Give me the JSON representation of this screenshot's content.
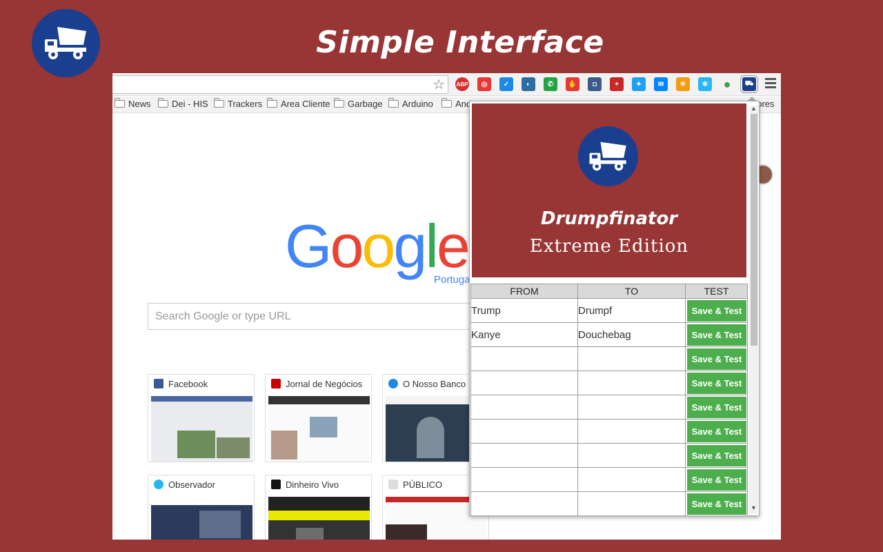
{
  "headline": "Simple Interface",
  "browser": {
    "bookmarks": [
      "News",
      "Dei - HIS",
      "Trackers",
      "Area Cliente",
      "Garbage",
      "Arduino",
      "And"
    ],
    "bookmarks_tail": "dores",
    "search_placeholder": "Search Google or type URL",
    "google_sub": "Portugal",
    "tiles": [
      "Facebook",
      "Jornal de Negócios",
      "O Nosso Banco",
      "Observador",
      "Dinheiro Vivo",
      "PÚBLICO"
    ],
    "extensions": [
      "adblock-icon",
      "adobe-icon",
      "chart-icon",
      "browser-icon",
      "whatsapp-icon",
      "stop-hand-icon",
      "instagram-icon",
      "plus-icon",
      "twitter-icon",
      "messenger-icon",
      "color-icon",
      "network-icon",
      "evernote-icon",
      "drumpfinator-icon"
    ]
  },
  "popup": {
    "title": "Drumpfinator",
    "subtitle": "Extreme Edition",
    "headers": {
      "from": "FROM",
      "to": "TO",
      "test": "TEST"
    },
    "button_label": "Save & Test",
    "rows": [
      {
        "from": "Trump",
        "to": "Drumpf"
      },
      {
        "from": "Kanye",
        "to": "Douchebag"
      },
      {
        "from": "",
        "to": ""
      },
      {
        "from": "",
        "to": ""
      },
      {
        "from": "",
        "to": ""
      },
      {
        "from": "",
        "to": ""
      },
      {
        "from": "",
        "to": ""
      },
      {
        "from": "",
        "to": ""
      },
      {
        "from": "",
        "to": ""
      }
    ]
  },
  "colors": {
    "background": "#983535",
    "brand_blue": "#1a3f8f",
    "button_green": "#4cae4c"
  }
}
